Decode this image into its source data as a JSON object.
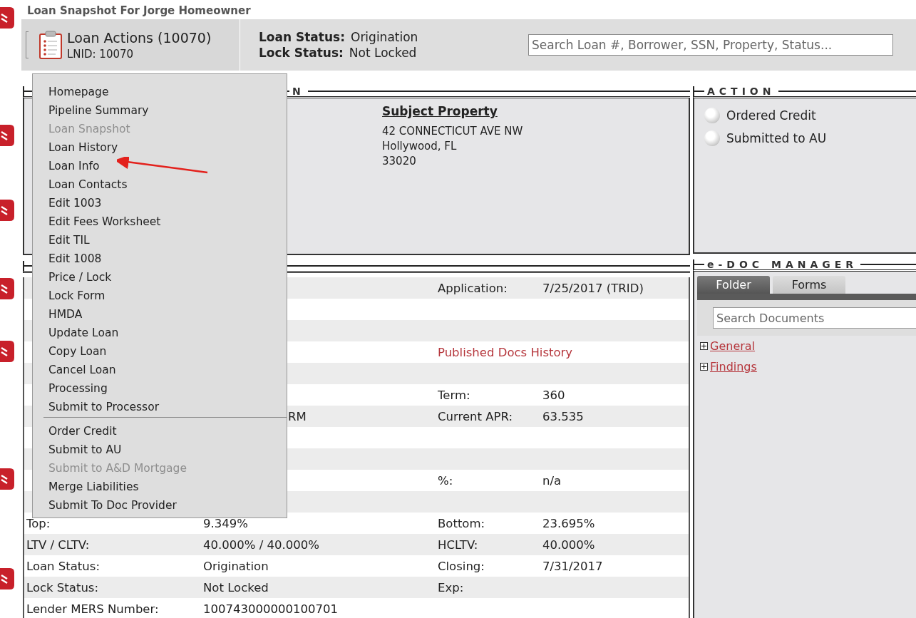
{
  "page_title": "Loan Snapshot For Jorge Homeowner",
  "loan_actions": {
    "title": "Loan Actions (10070)",
    "lnid": "LNID: 10070"
  },
  "status": [
    {
      "label": "Loan Status:",
      "value": "Origination"
    },
    {
      "label": "Lock Status:",
      "value": "Not Locked"
    }
  ],
  "search": {
    "placeholder": "Search Loan #, Borrower, SSN, Property, Status..."
  },
  "info_section": {
    "title": "N",
    "subject_property": {
      "heading": "Subject Property",
      "lines": [
        "42 CONNECTICUT AVE NW",
        "Hollywood, FL",
        "33020"
      ]
    }
  },
  "details_table": {
    "rows": [
      {
        "kind": "data",
        "label": "",
        "value": "",
        "label_2": "Application:",
        "value_2": "7/25/2017 (TRID)"
      },
      {
        "kind": "data",
        "label": "",
        "value": "",
        "label_2": "",
        "value_2": ""
      },
      {
        "kind": "data",
        "label": "",
        "value": "",
        "label_2": "",
        "value_2": ""
      },
      {
        "kind": "link",
        "label": "",
        "value": "",
        "label_2": "Published Docs History",
        "value_2": ""
      },
      {
        "kind": "data",
        "label": "",
        "value": "",
        "label_2": "",
        "value_2": ""
      },
      {
        "kind": "data",
        "label": "",
        "value": "",
        "label_2": "Term:",
        "value_2": "360"
      },
      {
        "kind": "tail",
        "label": "",
        "value": "RM",
        "label_2": "Current APR:",
        "value_2": "63.535"
      },
      {
        "kind": "data",
        "label": "",
        "value": "",
        "label_2": "",
        "value_2": ""
      },
      {
        "kind": "data",
        "label": "",
        "value": "",
        "label_2": "",
        "value_2": ""
      },
      {
        "kind": "data",
        "label": "",
        "value": "",
        "label_2": "%:",
        "value_2": "n/a"
      },
      {
        "kind": "data",
        "label": "",
        "value": "",
        "label_2": "",
        "value_2": ""
      },
      {
        "kind": "data",
        "label": "Top:",
        "value": "9.349%",
        "label_2": "Bottom:",
        "value_2": "23.695%"
      },
      {
        "kind": "data",
        "label": "LTV / CLTV:",
        "value": "40.000% / 40.000%",
        "label_2": "HCLTV:",
        "value_2": "40.000%"
      },
      {
        "kind": "data",
        "label": "Loan Status:",
        "value": "Origination",
        "label_2": "Closing:",
        "value_2": "7/31/2017"
      },
      {
        "kind": "data",
        "label": "Lock Status:",
        "value": "Not Locked",
        "label_2": "Exp:",
        "value_2": ""
      },
      {
        "kind": "data",
        "label": "Lender MERS Number:",
        "value": "100743000000100701",
        "label_2": "",
        "value_2": ""
      }
    ]
  },
  "action": {
    "title": "ACTION",
    "items": [
      {
        "label": "Ordered Credit",
        "checked": false
      },
      {
        "label": "Submitted to AU",
        "checked": false
      }
    ]
  },
  "edoc": {
    "title": "e-DOC MANAGER",
    "tabs": [
      {
        "label": "Folder",
        "selected": true
      },
      {
        "label": "Forms",
        "selected": false
      }
    ],
    "search": {
      "placeholder": "Search Documents"
    },
    "folders": [
      {
        "label": "General",
        "expanded": false
      },
      {
        "label": "Findings",
        "expanded": false
      }
    ]
  },
  "menu": {
    "groups": [
      [
        {
          "label": "Homepage",
          "disabled": false
        },
        {
          "label": "Pipeline Summary",
          "disabled": false
        },
        {
          "label": "Loan Snapshot",
          "disabled": true
        },
        {
          "label": "Loan History",
          "disabled": false
        },
        {
          "label": "Loan Info",
          "disabled": false
        },
        {
          "label": "Loan Contacts",
          "disabled": false
        },
        {
          "label": "Edit 1003",
          "disabled": false
        },
        {
          "label": "Edit Fees Worksheet",
          "disabled": false
        },
        {
          "label": "Edit TIL",
          "disabled": false
        },
        {
          "label": "Edit 1008",
          "disabled": false
        },
        {
          "label": "Price / Lock",
          "disabled": false
        },
        {
          "label": "Lock Form",
          "disabled": false
        },
        {
          "label": "HMDA",
          "disabled": false
        },
        {
          "label": "Update Loan",
          "disabled": false
        },
        {
          "label": "Copy Loan",
          "disabled": false
        },
        {
          "label": "Cancel Loan",
          "disabled": false
        },
        {
          "label": "Processing",
          "disabled": false
        },
        {
          "label": "Submit to Processor",
          "disabled": false
        }
      ],
      [
        {
          "label": "Order Credit",
          "disabled": false
        },
        {
          "label": "Submit to AU",
          "disabled": false
        },
        {
          "label": "Submit to A&D Mortgage",
          "disabled": true
        },
        {
          "label": "Merge Liabilities",
          "disabled": false
        },
        {
          "label": "Submit To Doc Provider",
          "disabled": false
        }
      ]
    ]
  }
}
